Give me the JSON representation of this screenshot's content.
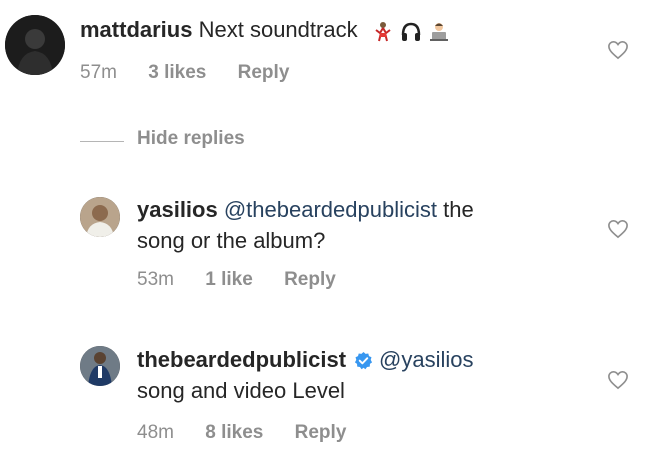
{
  "comments": [
    {
      "username": "mattdarius",
      "text": "Next soundtrack",
      "emojis": [
        "dancer-emoji",
        "headphones-emoji",
        "technologist-emoji"
      ],
      "time": "57m",
      "likes": "3 likes",
      "reply": "Reply"
    },
    {
      "username": "yasilios",
      "mention": "@thebeardedpublicist",
      "text_line1": "the",
      "text_line2": "song or the album?",
      "time": "53m",
      "likes": "1 like",
      "reply": "Reply"
    },
    {
      "username": "thebeardedpublicist",
      "verified": true,
      "mention": "@yasilios",
      "text": "song and video Level",
      "time": "48m",
      "likes": "8 likes",
      "reply": "Reply"
    }
  ],
  "hide_replies_label": "Hide replies",
  "colors": {
    "username": "#262626",
    "mention": "#28425f",
    "meta": "#8e8e8e",
    "verified": "#3897f0"
  },
  "icons": {
    "like": "heart-outline-icon",
    "verified": "verified-badge-icon"
  }
}
